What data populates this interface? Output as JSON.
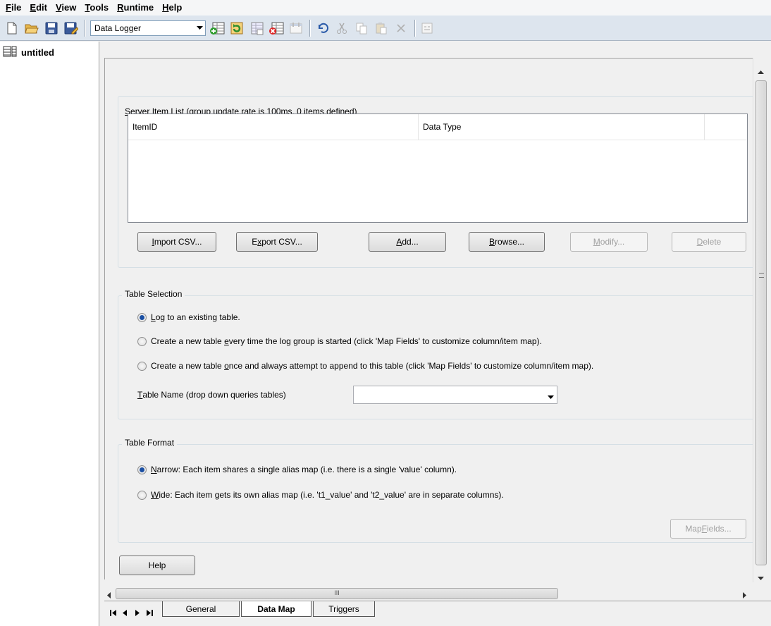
{
  "menu": [
    {
      "first": "F",
      "rest": "ile"
    },
    {
      "first": "E",
      "rest": "dit"
    },
    {
      "first": "V",
      "rest": "iew"
    },
    {
      "first": "T",
      "rest": "ools"
    },
    {
      "first": "R",
      "rest": "untime"
    },
    {
      "first": "H",
      "rest": "elp"
    }
  ],
  "toolbar": {
    "combo_value": "Data Logger",
    "icons": [
      "new-icon",
      "open-icon",
      "save-icon",
      "save-as-icon",
      "add-log-group-icon",
      "refresh-icon",
      "copy-log-group-icon",
      "delete-log-group-icon",
      "properties-icon",
      "undo-icon",
      "cut-icon",
      "copy-icon",
      "paste-icon",
      "delete-icon",
      "quick-client-icon"
    ]
  },
  "tree": {
    "root_label": "untitled"
  },
  "server_items": {
    "legend_first": "S",
    "legend_rest": "erver Item List (group update rate is 100ms, 0 items defined)",
    "columns": [
      "ItemID",
      "Data Type"
    ],
    "buttons": {
      "import": {
        "pre": "",
        "key": "I",
        "post": "mport CSV..."
      },
      "export": {
        "pre": "E",
        "key": "x",
        "post": "port CSV..."
      },
      "add": {
        "pre": "",
        "key": "A",
        "post": "dd..."
      },
      "browse": {
        "pre": "",
        "key": "B",
        "post": "rowse..."
      },
      "modify": {
        "pre": "",
        "key": "M",
        "post": "odify..."
      },
      "delete": {
        "pre": "",
        "key": "D",
        "post": "elete"
      }
    }
  },
  "table_selection": {
    "legend": "Table Selection",
    "options": [
      {
        "pre": "",
        "key": "L",
        "post": "og to an existing table.",
        "checked": true
      },
      {
        "pre": "Create a new table ",
        "key": "e",
        "post": "very time the log group is started (click 'Map Fields' to customize column/item map).",
        "checked": false
      },
      {
        "pre": "Create a new table ",
        "key": "o",
        "post": "nce and always attempt to append to this table (click 'Map Fields' to customize column/item map).",
        "checked": false
      }
    ],
    "table_name": {
      "key": "T",
      "post": "able Name (drop down queries tables)",
      "value": ""
    }
  },
  "table_format": {
    "legend": "Table Format",
    "options": [
      {
        "key": "N",
        "post": "arrow: Each item shares a single alias map (i.e. there is a single 'value' column).",
        "checked": true
      },
      {
        "key": "W",
        "post": "ide: Each item gets its own alias map (i.e. 't1_value' and 't2_value' are in separate columns).",
        "checked": false
      }
    ],
    "map_fields": {
      "pre": "Map ",
      "key": "F",
      "post": "ields..."
    }
  },
  "help_label": "Help",
  "hscroll_grip": "III",
  "tabs": [
    "General",
    "Data Map",
    "Triggers"
  ]
}
